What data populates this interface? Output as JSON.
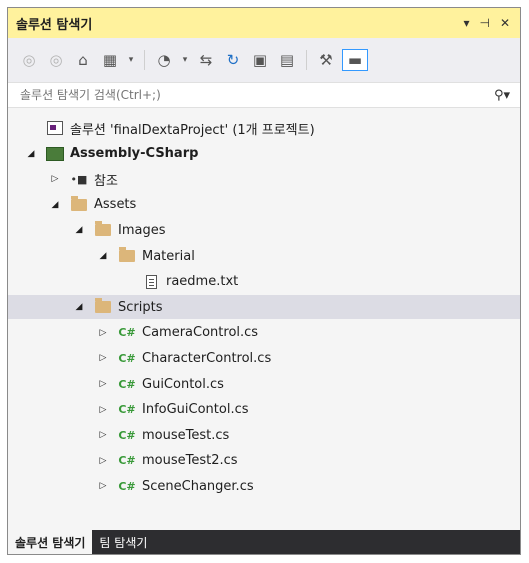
{
  "window": {
    "title": "솔루션 탐색기",
    "controls": [
      "▾",
      "⊣",
      "✕"
    ]
  },
  "toolbar": {
    "buttons": [
      {
        "icon": "back-icon",
        "glyph": "◎"
      },
      {
        "icon": "forward-icon",
        "glyph": "◎"
      },
      {
        "icon": "home-icon",
        "glyph": "⌂"
      },
      {
        "icon": "switch-views-icon",
        "glyph": "▦"
      },
      {
        "icon": "pending-changes-filter-icon",
        "glyph": "◔"
      },
      {
        "icon": "sync-with-active-document-icon",
        "glyph": "⇆"
      },
      {
        "icon": "refresh-icon",
        "glyph": "↻"
      },
      {
        "icon": "collapse-all-icon",
        "glyph": "▣"
      },
      {
        "icon": "show-all-files-icon",
        "glyph": "▤"
      },
      {
        "icon": "properties-icon",
        "glyph": "⚒"
      },
      {
        "icon": "preview-selected-items-icon",
        "glyph": "▬"
      }
    ]
  },
  "search": {
    "placeholder": "솔루션 탐색기 검색(Ctrl+;)",
    "icon_glyph": "⚲",
    "dropdown_glyph": "▾"
  },
  "tree": [
    {
      "label": "솔루션 'finalDextaProject' (1개 프로젝트)",
      "icon": "solution-icon",
      "level": 0,
      "arrow": "",
      "bold": false
    },
    {
      "label": "Assembly-CSharp",
      "icon": "csharp-project-icon",
      "level": 0,
      "arrow": "◢",
      "bold": true
    },
    {
      "label": "참조",
      "icon": "references-icon",
      "level": 1,
      "arrow": "▷",
      "bold": false
    },
    {
      "label": "Assets",
      "icon": "folder-icon",
      "level": 1,
      "arrow": "◢",
      "bold": false
    },
    {
      "label": "Images",
      "icon": "folder-icon",
      "level": 2,
      "arrow": "◢",
      "bold": false
    },
    {
      "label": "Material",
      "icon": "folder-icon",
      "level": 3,
      "arrow": "◢",
      "bold": false
    },
    {
      "label": "raedme.txt",
      "icon": "text-file-icon",
      "level": 4,
      "arrow": "",
      "bold": false
    },
    {
      "label": "Scripts",
      "icon": "folder-icon",
      "level": 2,
      "arrow": "◢",
      "bold": false,
      "selected": true
    },
    {
      "label": "CameraControl.cs",
      "icon": "csharp-file-icon",
      "level": 3,
      "arrow": "▷",
      "bold": false
    },
    {
      "label": "CharacterControl.cs",
      "icon": "csharp-file-icon",
      "level": 3,
      "arrow": "▷",
      "bold": false
    },
    {
      "label": "GuiContol.cs",
      "icon": "csharp-file-icon",
      "level": 3,
      "arrow": "▷",
      "bold": false
    },
    {
      "label": "InfoGuiContol.cs",
      "icon": "csharp-file-icon",
      "level": 3,
      "arrow": "▷",
      "bold": false
    },
    {
      "label": "mouseTest.cs",
      "icon": "csharp-file-icon",
      "level": 3,
      "arrow": "▷",
      "bold": false
    },
    {
      "label": "mouseTest2.cs",
      "icon": "csharp-file-icon",
      "level": 3,
      "arrow": "▷",
      "bold": false
    },
    {
      "label": "SceneChanger.cs",
      "icon": "csharp-file-icon",
      "level": 3,
      "arrow": "▷",
      "bold": false
    }
  ],
  "bottom_tabs": [
    {
      "label": "솔루션 탐색기",
      "active": true
    },
    {
      "label": "팀 탐색기",
      "active": false
    }
  ],
  "colors": {
    "title_bar": "#fff29d",
    "selection": "#dcdce4",
    "csharp_icon": "#3a9a3a",
    "folder": "#dcb67a",
    "tab_strip": "#2d2d30"
  }
}
